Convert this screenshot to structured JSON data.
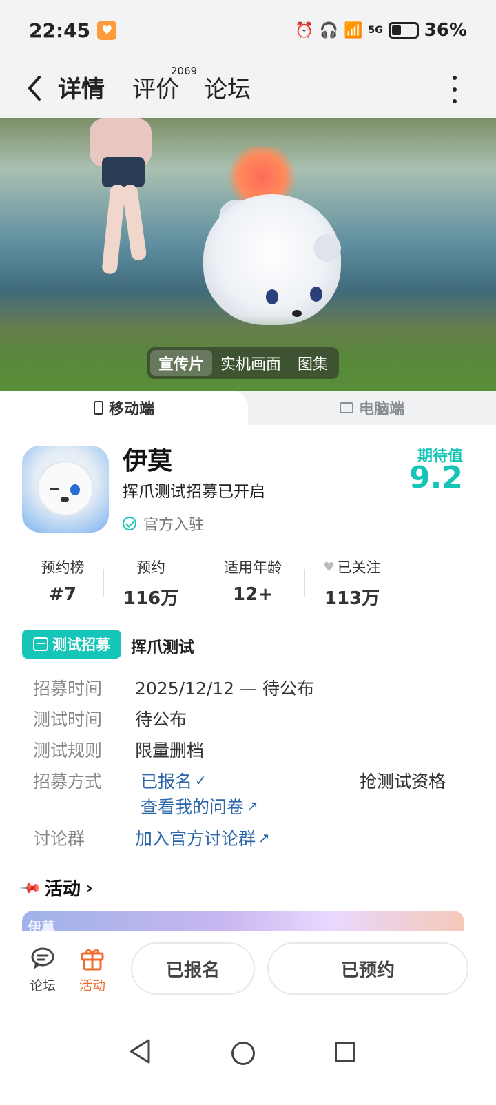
{
  "status_bar": {
    "time": "22:45",
    "network": "5G",
    "battery": "36%"
  },
  "nav": {
    "tabs": [
      {
        "label": "详情",
        "active": true
      },
      {
        "label": "评价",
        "count": "2069"
      },
      {
        "label": "论坛"
      }
    ]
  },
  "media_tabs": [
    "宣传片",
    "实机画面",
    "图集"
  ],
  "platform_tabs": [
    "移动端",
    "电脑端"
  ],
  "app": {
    "name": "伊莫",
    "subtitle": "挥爪测试招募已开启",
    "official": "官方入驻",
    "expect_label": "期待值",
    "expect_value": "9.2"
  },
  "stats": [
    {
      "label": "预约榜",
      "value": "#7"
    },
    {
      "label": "预约",
      "value": "116万"
    },
    {
      "label": "适用年龄",
      "value": "12+"
    },
    {
      "label": "已关注",
      "value": "113万"
    }
  ],
  "recruit": {
    "chip_label": "测试招募",
    "name": "挥爪测试",
    "rows": {
      "time_label": "招募时间",
      "time_value": "2025/12/12 — 待公布",
      "test_time_label": "测试时间",
      "test_time_value": "待公布",
      "rule_label": "测试规则",
      "rule_value": "限量删档",
      "method_label": "招募方式",
      "method_signed": "已报名",
      "method_questionnaire": "查看我的问卷",
      "method_grab": "抢测试资格",
      "group_label": "讨论群",
      "group_value": "加入官方讨论群"
    }
  },
  "activity": {
    "title": "活动",
    "banner_text": "伊莫"
  },
  "bottom": {
    "forum_label": "论坛",
    "activity_label": "活动",
    "signed_button": "已报名",
    "reserved_button": "已预约"
  },
  "colors": {
    "accent": "#15c5b8",
    "link": "#2a66a8",
    "activity": "#f16a2b"
  }
}
